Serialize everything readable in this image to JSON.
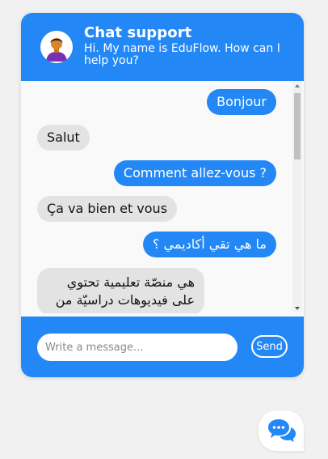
{
  "header": {
    "title": "Chat support",
    "subtitle": "Hi. My name is EduFlow. How can I help you?",
    "avatar_icon": "person-avatar-icon"
  },
  "messages": [
    {
      "sender": "user",
      "text": "Bonjour"
    },
    {
      "sender": "bot",
      "text": "Salut"
    },
    {
      "sender": "user",
      "text": "Comment allez-vous ?"
    },
    {
      "sender": "bot",
      "text": "Ça va bien et vous"
    },
    {
      "sender": "user",
      "text": "ما هي تقي أكاديمي ؟"
    },
    {
      "sender": "bot",
      "text": "هي منصّة تعليمية تحتوي على فيديوهات دراسيّة من"
    }
  ],
  "composer": {
    "placeholder": "Write a message...",
    "value": "",
    "send_label": "Send"
  },
  "launcher": {
    "icon": "chat-bubbles-icon"
  },
  "colors": {
    "brand": "#2388f5",
    "bot_bubble": "#e3e3e3",
    "background": "#f1f1f1"
  }
}
